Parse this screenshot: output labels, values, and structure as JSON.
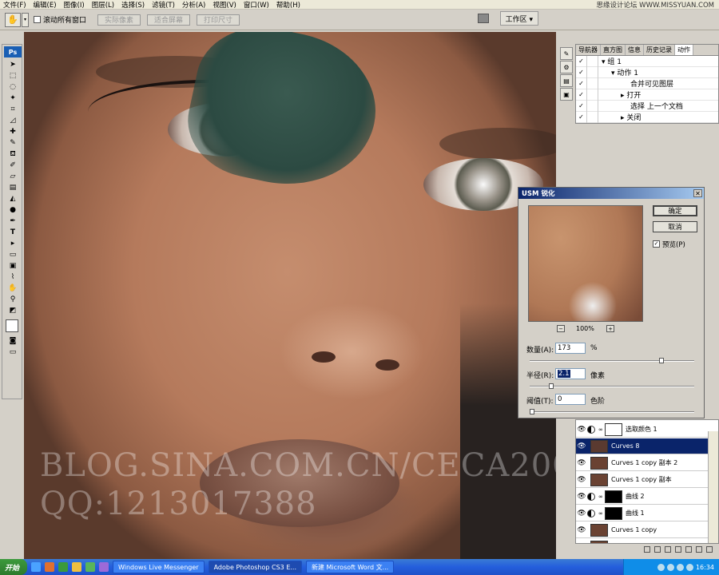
{
  "menubar": {
    "items": [
      "文件(F)",
      "编辑(E)",
      "图像(I)",
      "图层(L)",
      "选择(S)",
      "滤镜(T)",
      "分析(A)",
      "视图(V)",
      "窗口(W)",
      "帮助(H)"
    ],
    "watermark": "思缘设计论坛 WWW.MISSYUAN.COM"
  },
  "options": {
    "scroll_all_label": "滚动所有窗口",
    "actual_pixels": "实际像素",
    "fit_screen": "适合屏幕",
    "print_size": "打印尺寸",
    "workspace": "工作区 ▾"
  },
  "toolbox": {
    "logo": "Ps"
  },
  "canvas": {
    "watermark_line1": "BLOG.SINA.COM.CN/CECA2002",
    "watermark_line2": "QQ:1213017388"
  },
  "actions_panel": {
    "tabs": [
      "导航器",
      "直方图",
      "信息",
      "历史记录",
      "动作"
    ],
    "rows": [
      {
        "label": "▾ 组 1",
        "indent": 0
      },
      {
        "label": "▾ 动作 1",
        "indent": 1
      },
      {
        "label": "合并可见图层",
        "indent": 3
      },
      {
        "label": "▸ 打开",
        "indent": 2
      },
      {
        "label": "选择 上一个文档",
        "indent": 3
      },
      {
        "label": "▸ 关闭",
        "indent": 2
      }
    ]
  },
  "usm": {
    "title": "USM 锐化",
    "ok": "确定",
    "cancel": "取消",
    "preview_label": "预览(P)",
    "zoom": "100%",
    "amount_label": "数量(A):",
    "amount_value": "173",
    "amount_unit": "%",
    "radius_label": "半径(R):",
    "radius_value": "2.1",
    "radius_unit": "像素",
    "threshold_label": "阈值(T):",
    "threshold_value": "0",
    "threshold_unit": "色阶",
    "amount_level": 0.81,
    "radius_level": 0.12,
    "threshold_level": 0.0
  },
  "layers": {
    "rows": [
      {
        "label": "选取颜色 1",
        "type": "adj",
        "thumb": "#ffffff",
        "selected": false
      },
      {
        "label": "Curves 8",
        "type": "img",
        "thumb": "#5a3a30",
        "selected": true
      },
      {
        "label": "Curves 1 copy 副本 2",
        "type": "img",
        "thumb": "#6a4232",
        "selected": false
      },
      {
        "label": "Curves 1 copy 副本",
        "type": "img",
        "thumb": "#6a4232",
        "selected": false
      },
      {
        "label": "曲线 2",
        "type": "adj",
        "thumb": "#000000",
        "selected": false
      },
      {
        "label": "曲线 1",
        "type": "adj",
        "thumb": "#000000",
        "selected": false
      },
      {
        "label": "Curves 1 copy",
        "type": "img",
        "thumb": "#6a4232",
        "selected": false
      },
      {
        "label": "背景",
        "type": "img",
        "thumb": "#6a4232",
        "selected": false
      }
    ]
  },
  "taskbar": {
    "start": "开始",
    "tasks": [
      "Windows Live Messenger",
      "Adobe Photoshop CS3 E...",
      "新建 Microsoft Word 文..."
    ],
    "clock": "16:34"
  }
}
